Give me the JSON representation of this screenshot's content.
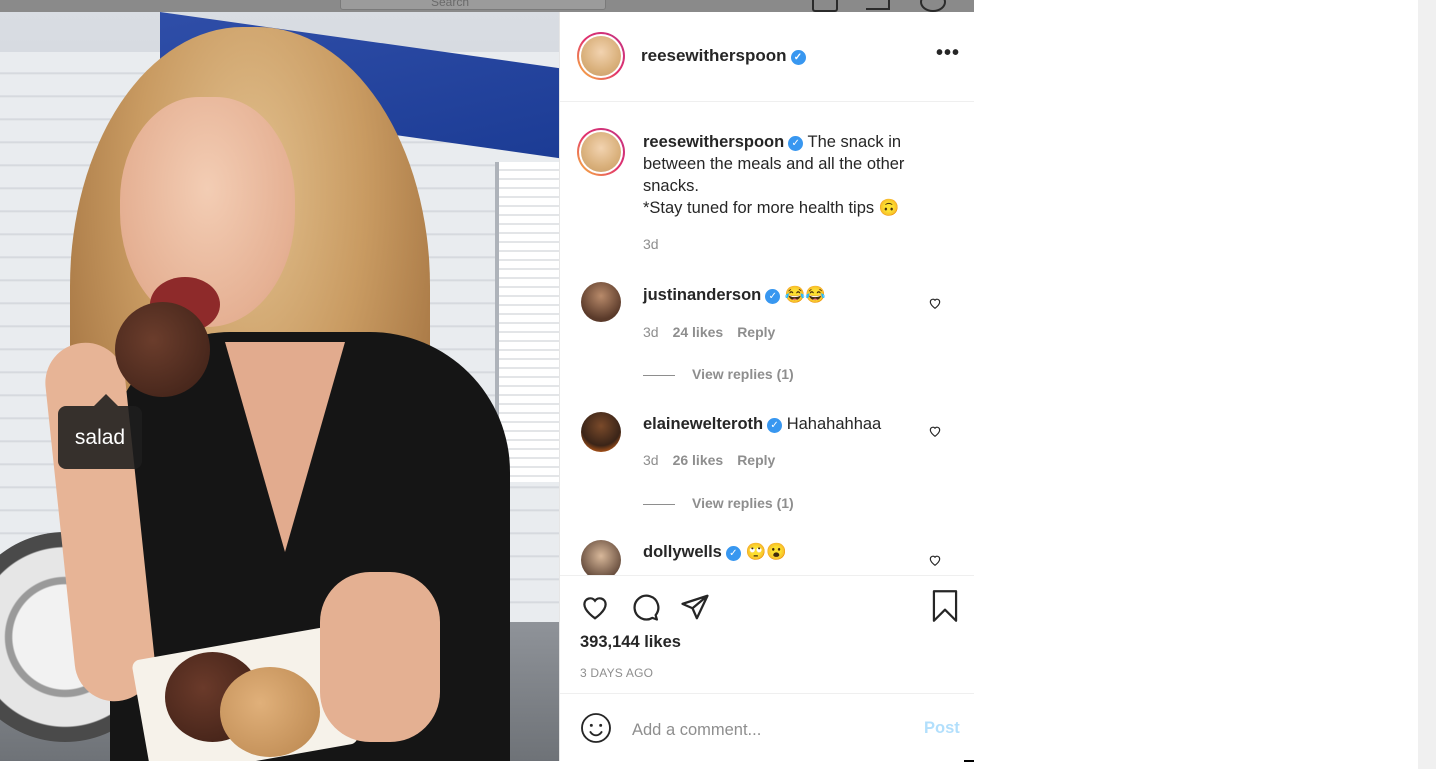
{
  "topbar": {
    "search_placeholder": "Search"
  },
  "photo": {
    "tag_label": "salad"
  },
  "header": {
    "username": "reesewitherspoon",
    "verified_icon": "verified-badge-icon",
    "more_icon": "more-options-icon"
  },
  "caption": {
    "username": "reesewitherspoon",
    "text": "The snack in between the meals and all the other snacks.",
    "text2": "*Stay tuned for more health tips 🙃",
    "time": "3d"
  },
  "comments": [
    {
      "username": "justinanderson",
      "text": "😂😂",
      "time": "3d",
      "likes": "24 likes",
      "reply": "Reply",
      "view_replies": "View replies (1)"
    },
    {
      "username": "elainewelteroth",
      "text": "Hahahahhaa",
      "time": "3d",
      "likes": "26 likes",
      "reply": "Reply",
      "view_replies": "View replies (1)"
    },
    {
      "username": "dollywells",
      "text": "🙄😮"
    }
  ],
  "actions": {
    "likes": "393,144 likes",
    "time_ago": "3 DAYS AGO"
  },
  "add_comment": {
    "placeholder": "Add a comment...",
    "post_label": "Post"
  },
  "colors": {
    "accent": "#3897f0",
    "text": "#262626",
    "muted": "#8e8e8e",
    "post_disabled": "#b2dffc"
  }
}
